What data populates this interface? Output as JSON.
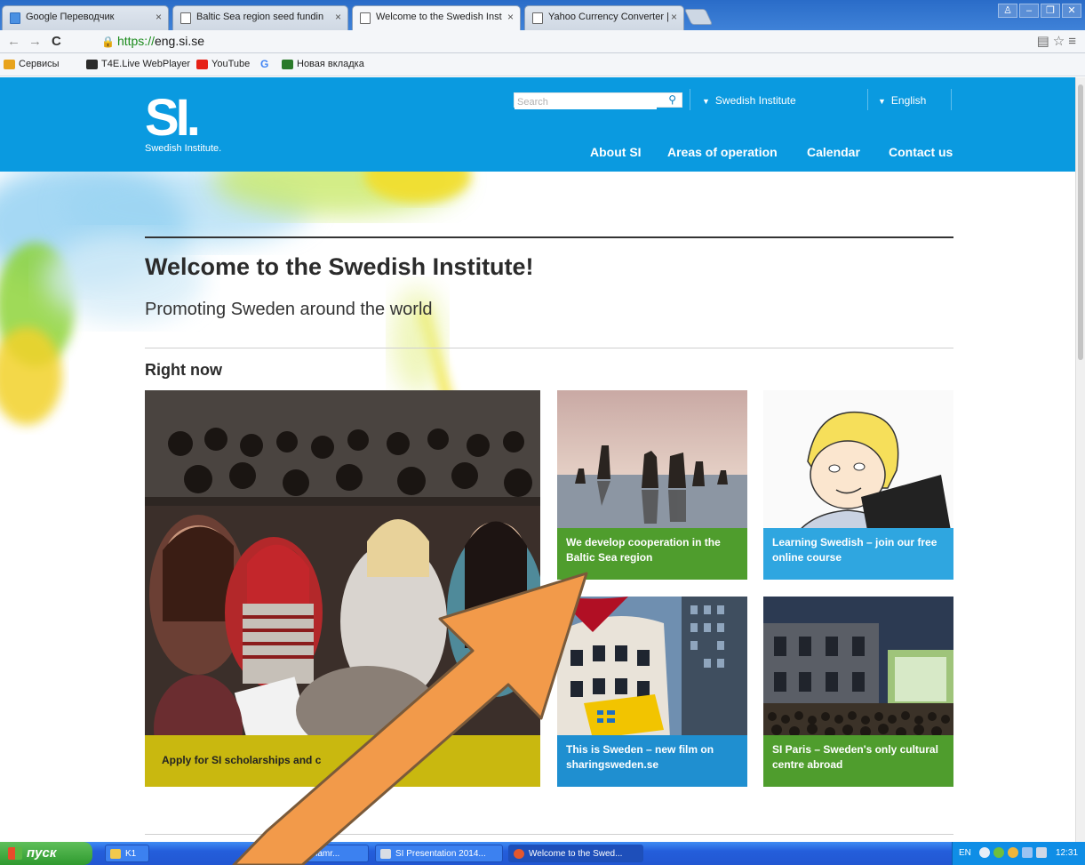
{
  "browser": {
    "tabs": [
      {
        "title": "Google Переводчик",
        "active": false
      },
      {
        "title": "Baltic Sea region seed fundin",
        "active": false
      },
      {
        "title": "Welcome to the Swedish Inst",
        "active": true
      },
      {
        "title": "Yahoo Currency Converter |",
        "active": false
      }
    ],
    "url_scheme": "https://",
    "url_host": "eng.si.se",
    "bookmarks": [
      {
        "label": "Сервисы",
        "color": "#e8a31c"
      },
      {
        "label": "T4E.Live WebPlayer",
        "color": "#2b2b2b"
      },
      {
        "label": "YouTube",
        "color": "#e62117"
      },
      {
        "label": "G",
        "color": "#4285f4"
      },
      {
        "label": "Новая вкладка",
        "color": "#2a7a2a"
      }
    ]
  },
  "site": {
    "logo_mark": "SI.",
    "logo_sub": "Swedish Institute.",
    "search_placeholder": "Search",
    "org_menu": "Swedish Institute",
    "lang_menu": "English",
    "nav": [
      "About SI",
      "Areas of operation",
      "Calendar",
      "Contact us"
    ],
    "welcome_title": "Welcome to the Swedish Institute!",
    "tagline": "Promoting Sweden around the world",
    "section_heading": "Right now",
    "tiles": [
      {
        "caption": "Apply for SI scholarships and c",
        "color": "#c9b80f"
      },
      {
        "caption": "We develop cooperation in the Baltic Sea region",
        "color": "#4f9d2d"
      },
      {
        "caption": "Learning Swedish – join our free online course",
        "color": "#2fa6e0"
      },
      {
        "caption": "This is Sweden – new film on sharingsweden.se",
        "color": "#1f8fd0"
      },
      {
        "caption": "SI Paris – Sweden's only cultural centre abroad",
        "color": "#4f9d2d"
      }
    ],
    "accent_color": "#0a9ae0"
  },
  "taskbar": {
    "start_label": "пуск",
    "tasks": [
      "K1",
      "mamr...",
      "SI Presentation 2014...",
      "Welcome to the Swed..."
    ],
    "lang": "EN",
    "clock": "12:31"
  }
}
